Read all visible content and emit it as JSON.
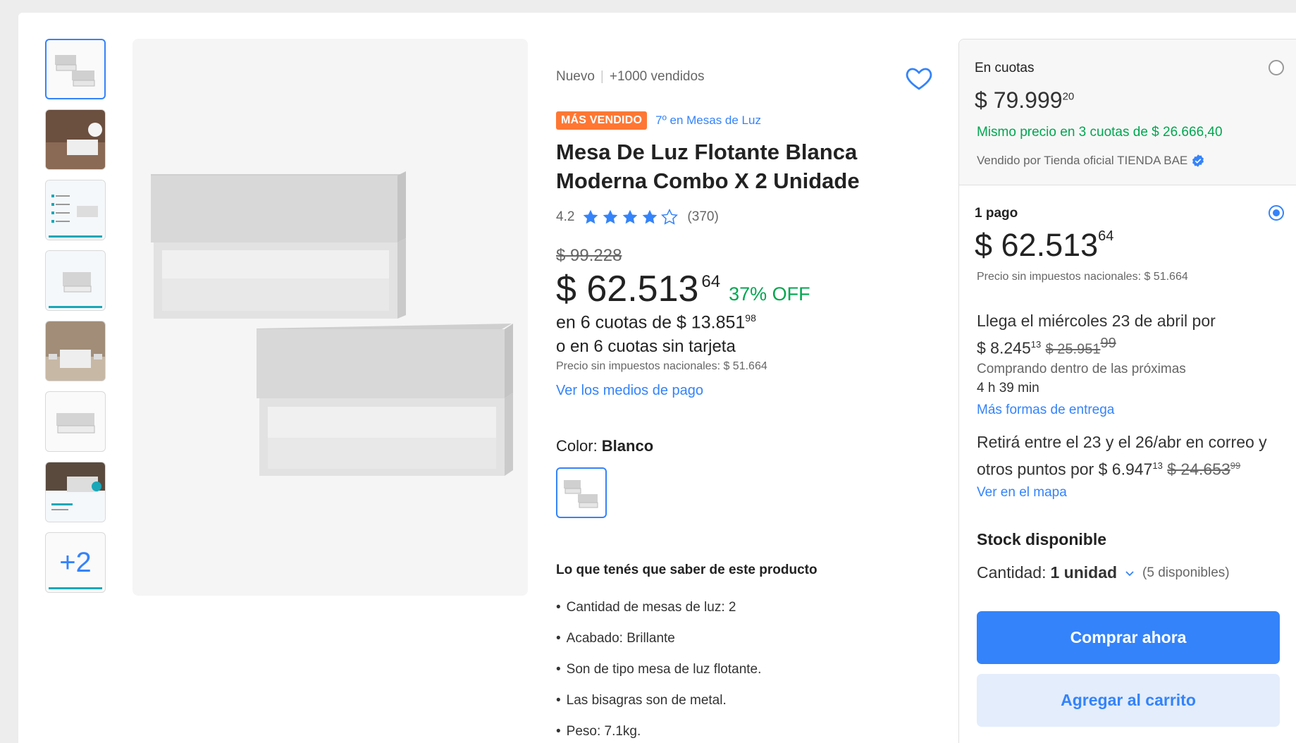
{
  "thumbnails": [
    {
      "kind": "product"
    },
    {
      "kind": "room"
    },
    {
      "kind": "specs"
    },
    {
      "kind": "dimensions"
    },
    {
      "kind": "bedroom"
    },
    {
      "kind": "single"
    },
    {
      "kind": "promo"
    },
    {
      "kind": "more",
      "label": "+2"
    }
  ],
  "info": {
    "condition": "Nuevo",
    "sold": "+1000 vendidos",
    "badge": "MÁS VENDIDO",
    "rank": "7º en Mesas de Luz",
    "title": "Mesa De Luz Flotante Blanca Moderna Combo X 2 Unidade",
    "rating": "4.2",
    "rating_value": 4.2,
    "reviews": "(370)",
    "old_price": "$ 99.228",
    "price": "$ 62.513",
    "price_cents": "64",
    "discount": "37% OFF",
    "installments_text": "en 6 cuotas de $ 13.851",
    "installments_cents": "98",
    "no_card": "o en 6 cuotas sin tarjeta",
    "tax_note": "Precio sin impuestos nacionales: $ 51.664",
    "pay_link": "Ver los medios de pago",
    "color_label": "Color: ",
    "color_value": "Blanco",
    "know_title": "Lo que tenés que saber de este producto",
    "features": [
      "Cantidad de mesas de luz: 2",
      "Acabado: Brillante",
      "Son de tipo mesa de luz flotante.",
      "Las bisagras son de metal.",
      "Peso: 7.1kg."
    ]
  },
  "buybox": {
    "cuotas_label": "En cuotas",
    "cuotas_price": "$ 79.999",
    "cuotas_cents": "20",
    "same_price": "Mismo precio en 3 cuotas de $ 26.666,40",
    "seller": "Vendido por Tienda oficial TIENDA BAE",
    "one_pay_label": "1 pago",
    "one_pay_price": "$ 62.513",
    "one_pay_cents": "64",
    "tax_note": "Precio sin impuestos nacionales: $ 51.664",
    "arrive_text": "Llega el miércoles 23 de abril por",
    "ship_price": "$ 8.245",
    "ship_cents": "13",
    "ship_old": "$ 25.951",
    "ship_old_cents": "99",
    "buying_within": "Comprando dentro de las próximas",
    "time_left": "4 h 39 min",
    "more_delivery": "Más formas de entrega",
    "pickup_text": "Retirá entre el 23 y el 26/abr en correo y otros puntos por",
    "pickup_price": "$ 6.947",
    "pickup_cents": "13",
    "pickup_old": "$ 24.653",
    "pickup_old_cents": "99",
    "map_link": "Ver en el mapa",
    "stock": "Stock disponible",
    "qty_label": "Cantidad:",
    "qty_value": "1 unidad",
    "qty_available": "(5 disponibles)",
    "buy_now": "Comprar ahora",
    "add_cart": "Agregar al carrito"
  },
  "colors": {
    "accent": "#3483fa",
    "green": "#00a650",
    "badge": "#ff7733"
  }
}
